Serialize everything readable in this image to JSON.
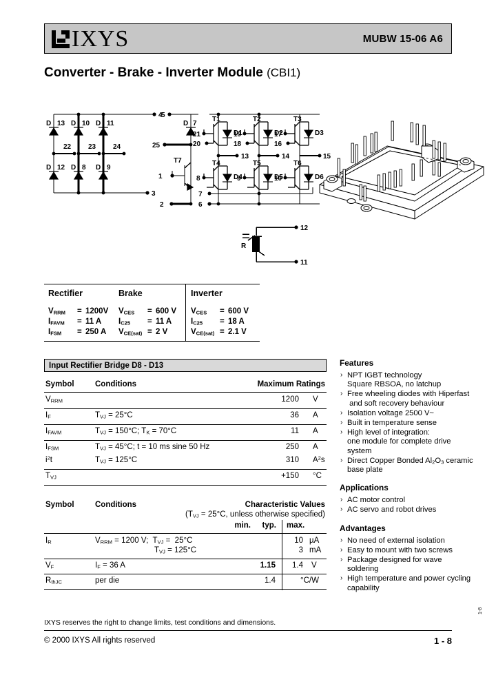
{
  "header": {
    "logo_text": "IXYS",
    "logo_icon": "ixys-square-logo",
    "part_number": "MUBW 15-06 A6"
  },
  "title": {
    "main": "Converter - Brake - Inverter Module ",
    "suffix": "(CBI1)"
  },
  "schematic": {
    "caption": "circuit diagram",
    "rectifier_diodes_top": [
      "D 13",
      "D 10",
      "D 11"
    ],
    "rectifier_diodes_bottom": [
      "D 12",
      "D 8",
      "D 9"
    ],
    "rectifier_ac_terminals": [
      "22",
      "23",
      "24"
    ],
    "dc_plus_terminal": "4",
    "dc_minus_terminal": "3",
    "brake_terminal_top": "5",
    "brake_diode": "D 7",
    "brake_igbt": "T7",
    "brake_terminals": [
      "25",
      "1",
      "2"
    ],
    "inverter_igbts_top": [
      "T1",
      "T2",
      "T3"
    ],
    "inverter_diodes_top": [
      "D1",
      "D2",
      "D3"
    ],
    "inverter_igbts_bottom": [
      "T4",
      "T5",
      "T6"
    ],
    "inverter_diodes_bottom": [
      "D4",
      "D5",
      "D6"
    ],
    "inverter_gate_terminals_top": [
      "21",
      "20",
      "19",
      "18",
      "17",
      "16"
    ],
    "inverter_output_terminals": [
      "13",
      "14",
      "15"
    ],
    "inverter_gate_terminals_bottom": [
      "8",
      "9",
      "10"
    ],
    "inverter_emitter_terminal": "7",
    "inverter_dc_minus_terminal": "6",
    "thermistor_label": "R",
    "thermistor_terminals": [
      "12",
      "11"
    ]
  },
  "module_drawing": {
    "name": "cbi1-power-module-outline"
  },
  "summary": {
    "columns": [
      "Rectifier",
      "Brake",
      "Inverter"
    ],
    "rectifier": [
      {
        "symbol": "V",
        "sub": "RRM",
        "value": "1200V"
      },
      {
        "symbol": "I",
        "sub": "FAVM",
        "value": "11 A"
      },
      {
        "symbol": "I",
        "sub": "FSM",
        "value": "250 A"
      }
    ],
    "brake": [
      {
        "symbol": "V",
        "sub": "CES",
        "value": "600 V"
      },
      {
        "symbol": "I",
        "sub": "C25",
        "value": "11 A"
      },
      {
        "symbol": "V",
        "sub": "CE(sat)",
        "value": "2 V"
      }
    ],
    "inverter": [
      {
        "symbol": "V",
        "sub": "CES",
        "value": "600 V"
      },
      {
        "symbol": "I",
        "sub": "C25",
        "value": "18 A"
      },
      {
        "symbol": "V",
        "sub": "CE(sat)",
        "value": "2.1 V"
      }
    ],
    "equals": "="
  },
  "table1": {
    "band_title": "Input Rectifier Bridge D8 - D13",
    "headers": {
      "symbol": "Symbol",
      "conditions": "Conditions",
      "ratings": "Maximum Ratings"
    },
    "rows": [
      {
        "symbol": "V",
        "sub": "RRM",
        "conditions": "",
        "value": "1200",
        "unit": "V"
      },
      {
        "symbol": "I",
        "sub": "F",
        "conditions": "T_VJ = 25°C",
        "value": "36",
        "unit": "A"
      },
      {
        "symbol": "I",
        "sub": "FAVM",
        "conditions": "T_VJ = 150°C; T_K = 70°C",
        "value": "11",
        "unit": "A"
      },
      {
        "symbol": "I",
        "sub": "FSM",
        "conditions": "T_VJ = 45°C; t = 10 ms sine 50 Hz",
        "value": "250",
        "unit": "A"
      },
      {
        "symbol": "i²t",
        "sub": "",
        "conditions": "T_VJ = 125°C",
        "value": "310",
        "unit": "A²s"
      },
      {
        "symbol": "T",
        "sub": "VJ",
        "conditions": "",
        "value": "+150",
        "unit": "°C"
      }
    ]
  },
  "table2": {
    "headers": {
      "symbol": "Symbol",
      "conditions": "Conditions",
      "char_values": "Characteristic Values",
      "char_note": "(T_VJ = 25°C, unless otherwise specified)",
      "min": "min.",
      "typ": "typ.",
      "max": "max."
    },
    "rows": [
      {
        "symbol": "I",
        "sub": "R",
        "cond1": "V_RRM = 1200 V;  T_VJ =   25°C",
        "cond2": "T_VJ = 125°C",
        "min": "",
        "typ": "",
        "max": "10",
        "max2": "3",
        "unit": "µA",
        "unit2": "mA"
      },
      {
        "symbol": "V",
        "sub": "F",
        "cond1": "I_F = 36 A",
        "cond2": "",
        "min": "",
        "typ": "1.15",
        "max": "1.4",
        "max2": "",
        "unit": "V",
        "unit2": ""
      },
      {
        "symbol": "R",
        "sub": "thJC",
        "cond1": "per die",
        "cond2": "",
        "min": "",
        "typ": "1.4",
        "max": "",
        "max2": "",
        "unit": "°C/W",
        "unit2": ""
      }
    ]
  },
  "features": {
    "title": "Features",
    "items": [
      "NPT IGBT technology\nSquare RBSOA, no latchup",
      "Free wheeling diodes with Hiperfast\n and soft recovery behaviour",
      "Isolation voltage 2500 V~",
      "Built in temperature sense",
      "High level of integration:\none module for complete drive\nsystem",
      "Direct Copper Bonded Al₂O₃ ceramic\nbase plate"
    ]
  },
  "applications": {
    "title": "Applications",
    "items": [
      "AC motor control",
      "AC servo and robot drives"
    ]
  },
  "advantages": {
    "title": "Advantages",
    "items": [
      "No need of external isolation",
      "Easy to mount with two screws",
      "Package designed for wave\nsoldering",
      "High temperature and power cycling\ncapability"
    ]
  },
  "footer": {
    "note": "IXYS reserves the right to change limits, test conditions and dimensions.",
    "copyright": "© 2000 IXYS All rights reserved",
    "page": "1 - 8",
    "side_code": "1-8"
  },
  "colors": {
    "header_band": "#c6c6c6",
    "table_band": "#d9d9d9",
    "ink": "#000000",
    "paper": "#ffffff"
  }
}
